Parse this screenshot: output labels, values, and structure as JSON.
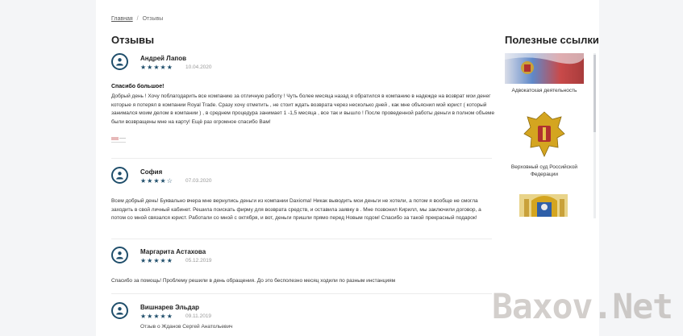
{
  "breadcrumb": {
    "home": "Главная",
    "separator": "/",
    "current": "Отзывы"
  },
  "page_title": "Отзывы",
  "sidebar": {
    "title": "Полезные ссылки",
    "links": [
      {
        "label": "Адвокатская деятельность",
        "icon": "flag-emblem-icon"
      },
      {
        "label": "Верховный суд Российской Федерации",
        "icon": "supreme-court-emblem-icon"
      },
      {
        "label": "",
        "icon": "coat-of-arms-icon"
      }
    ]
  },
  "reviews": [
    {
      "author": "Андрей Лапов",
      "stars": "★★★★★",
      "rating": 5,
      "date": "10.04.2020",
      "heading": "Спасибо большое!",
      "body": "Добрый день ! Хочу поблагодарить все компанию за отличную работу ! Чуть более месяца назад я обратился в компанию  в надежде на возврат мои денег которые я потерял в компании Royal Trade. Сразу хочу отметить , не стоит ждать возврата через несколько дней , как мне объяснил мой юрист ( который занимался моим делом в компании ) , в среднем процедура занимает 1 -1,5 месяца , все так и вышло ! После проведенной работы деньги в полном объеме были возвращены мне на карту! Ещё раз огромное спасибо Вам!"
    },
    {
      "author": "София",
      "stars": "★★★★☆",
      "rating": 4,
      "date": "07.03.2020",
      "body": "Всем добрый день! Буквально вчера мне вернулись деньги из компании Daxioma! Никак выводить мои деньги не хотели, а потом я вообще не смогла заходить в свой личный кабинет. Решила поискать фирму для возврата средств, и оставила заявку в . Мне позвонил Кирилл, мы заключили договор, а потом со мной связался юрист. Работали со мной с октября, и вот, деньги пришли прямо перед Новым годом! Спасибо за такой прекрасный подарок!"
    },
    {
      "author": "Маргарита Астахова",
      "stars": "★★★★★",
      "rating": 5,
      "date": "05.12.2019",
      "body": "Спасибо за помощь! Проблему решили в день обращения. До это бесполезно месяц ходили по разным инстанциям"
    },
    {
      "author": "Вишнарев Эльдар",
      "stars": "★★★★★",
      "rating": 5,
      "date": "09.11.2019",
      "subject": "Отзыв о Жданов Сергей Анатольевич"
    }
  ],
  "watermark": "Baxov.Net",
  "colors": {
    "accent": "#1f4e6b",
    "background": "#f4f5f7",
    "card": "#ffffff"
  }
}
